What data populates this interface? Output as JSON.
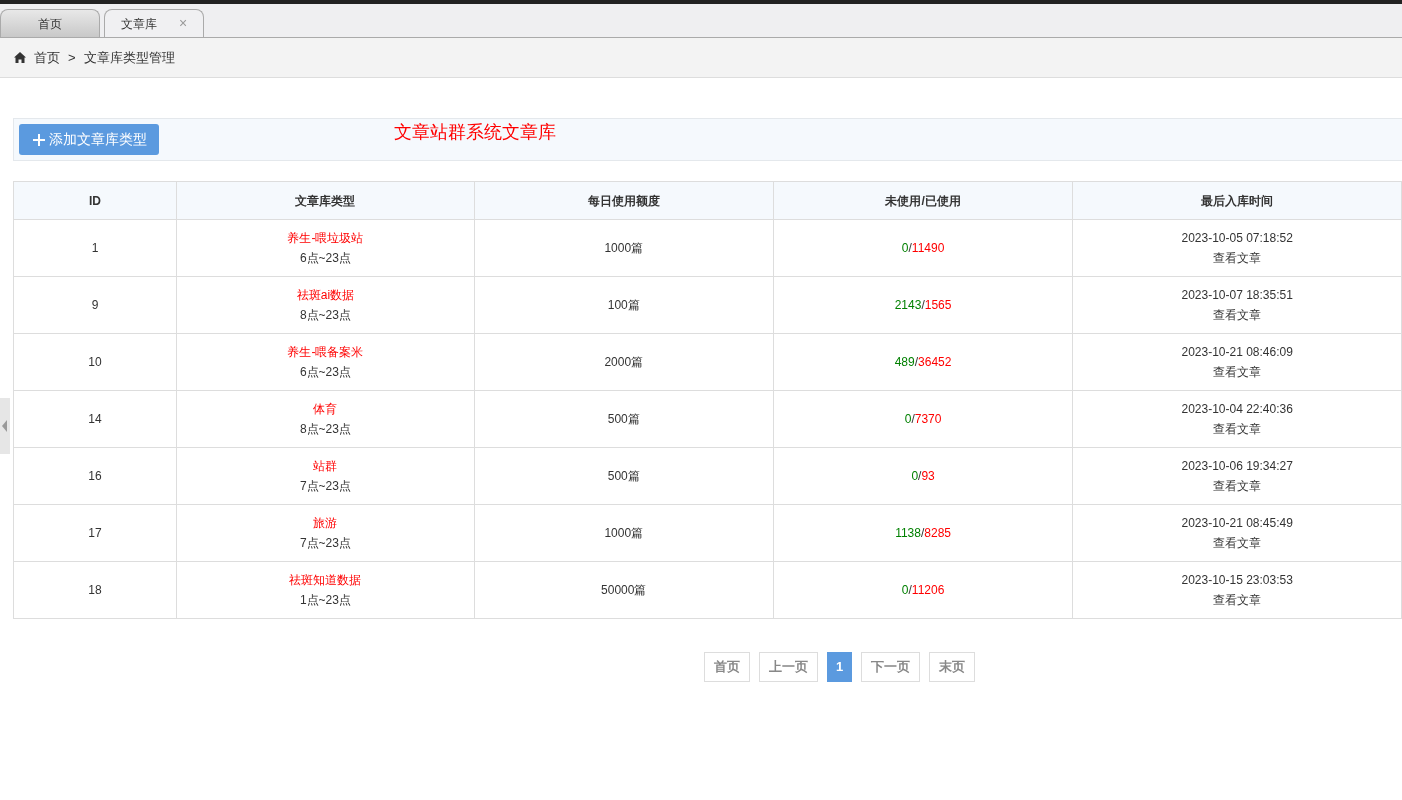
{
  "tabs": [
    {
      "label": "首页",
      "selected": false
    },
    {
      "label": "文章库",
      "selected": true,
      "close_glyph": "×"
    }
  ],
  "breadcrumb": {
    "items": [
      "首页",
      "文章库类型管理"
    ],
    "separator": ">"
  },
  "toolbar": {
    "add_button": "添加文章库类型",
    "title": "文章站群系统文章库"
  },
  "table": {
    "usage_separator": "/",
    "columns": [
      "ID",
      "文章库类型",
      "每日使用额度",
      "未使用/已使用",
      "最后入库时间"
    ],
    "rows": [
      {
        "id": "1",
        "type": "养生-喂垃圾站",
        "hours": "6点~23点",
        "quota": "1000篇",
        "unused": "0",
        "used": "11490",
        "last_time": "2023-10-05 07:18:52",
        "link": "查看文章"
      },
      {
        "id": "9",
        "type": "祛斑ai数据",
        "hours": "8点~23点",
        "quota": "100篇",
        "unused": "2143",
        "used": "1565",
        "last_time": "2023-10-07 18:35:51",
        "link": "查看文章"
      },
      {
        "id": "10",
        "type": "养生-喂备案米",
        "hours": "6点~23点",
        "quota": "2000篇",
        "unused": "489",
        "used": "36452",
        "last_time": "2023-10-21 08:46:09",
        "link": "查看文章"
      },
      {
        "id": "14",
        "type": "体育",
        "hours": "8点~23点",
        "quota": "500篇",
        "unused": "0",
        "used": "7370",
        "last_time": "2023-10-04 22:40:36",
        "link": "查看文章"
      },
      {
        "id": "16",
        "type": "站群",
        "hours": "7点~23点",
        "quota": "500篇",
        "unused": "0",
        "used": "93",
        "last_time": "2023-10-06 19:34:27",
        "link": "查看文章"
      },
      {
        "id": "17",
        "type": "旅游",
        "hours": "7点~23点",
        "quota": "1000篇",
        "unused": "1138",
        "used": "8285",
        "last_time": "2023-10-21 08:45:49",
        "link": "查看文章"
      },
      {
        "id": "18",
        "type": "祛斑知道数据",
        "hours": "1点~23点",
        "quota": "50000篇",
        "unused": "0",
        "used": "11206",
        "last_time": "2023-10-15 23:03:53",
        "link": "查看文章"
      }
    ]
  },
  "pagination": [
    {
      "label": "首页",
      "selected": false
    },
    {
      "label": "上一页",
      "selected": false
    },
    {
      "label": "1",
      "selected": true
    },
    {
      "label": "下一页",
      "selected": false
    },
    {
      "label": "末页",
      "selected": false
    }
  ]
}
